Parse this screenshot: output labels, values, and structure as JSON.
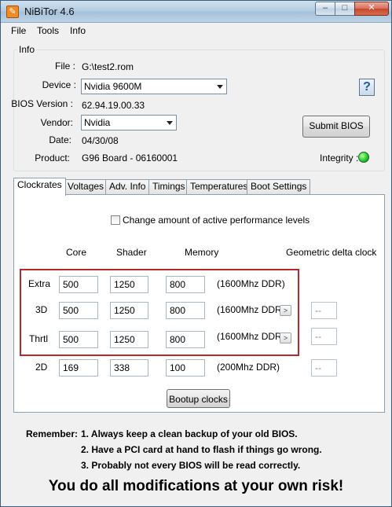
{
  "window": {
    "title": "NiBiTor 4.6",
    "app_icon": "nibitor-app-icon",
    "minimize": "–",
    "maximize": "□",
    "close": "✕"
  },
  "menu": {
    "file": "File",
    "tools": "Tools",
    "info": "Info"
  },
  "info": {
    "legend": "Info",
    "file_label": "File :",
    "file_value": "G:\\test2.rom",
    "device_label": "Device :",
    "device_value": "Nvidia 9600M",
    "bios_label": "BIOS Version :",
    "bios_value": "62.94.19.00.33",
    "vendor_label": "Vendor:",
    "vendor_value": "Nvidia",
    "date_label": "Date:",
    "date_value": "04/30/08",
    "product_label": "Product:",
    "product_value": "G96 Board - 06160001",
    "submit_label": "Submit BIOS",
    "help_glyph": "?",
    "integrity_label": "Integrity :",
    "integrity_color": "#22c42c"
  },
  "tabs": [
    "Clockrates",
    "Voltages",
    "Adv. Info",
    "Timings",
    "Temperatures",
    "Boot Settings"
  ],
  "clock": {
    "change_levels_label": "Change amount of active performance levels",
    "headers": {
      "core": "Core",
      "shader": "Shader",
      "memory": "Memory",
      "geo": "Geometric delta clock"
    },
    "rows": [
      {
        "label": "Extra",
        "core": "500",
        "shader": "1250",
        "memory": "800",
        "note": "(1600Mhz DDR)",
        "geo": ""
      },
      {
        "label": "3D",
        "core": "500",
        "shader": "1250",
        "memory": "800",
        "note": "(1600Mhz DDR)",
        "geo": "--"
      },
      {
        "label": "Thrtl",
        "core": "500",
        "shader": "1250",
        "memory": "800",
        "note": "(1600Mhz DDR)",
        "geo": "--"
      },
      {
        "label": "2D",
        "core": "169",
        "shader": "338",
        "memory": "100",
        "note": "(200Mhz DDR)",
        "geo": "--"
      }
    ],
    "bootup_label": "Bootup clocks",
    "highlight_color": "#b42a2a"
  },
  "notes": {
    "remember": "Remember:",
    "line1": "1. Always keep a clean backup of your old BIOS.",
    "line2": "2. Have a PCI card at hand to flash if things go wrong.",
    "line3": "3. Probably not every BIOS will be read correctly.",
    "risk": "You do all modifications at your own risk!"
  }
}
